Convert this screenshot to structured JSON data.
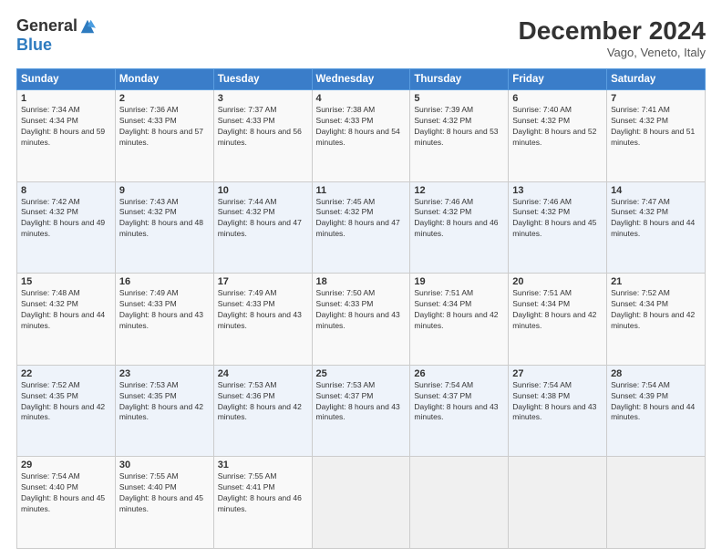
{
  "logo": {
    "general": "General",
    "blue": "Blue"
  },
  "title": "December 2024",
  "location": "Vago, Veneto, Italy",
  "headers": [
    "Sunday",
    "Monday",
    "Tuesday",
    "Wednesday",
    "Thursday",
    "Friday",
    "Saturday"
  ],
  "weeks": [
    [
      {
        "day": "1",
        "sunrise": "7:34 AM",
        "sunset": "4:34 PM",
        "daylight": "8 hours and 59 minutes."
      },
      {
        "day": "2",
        "sunrise": "7:36 AM",
        "sunset": "4:33 PM",
        "daylight": "8 hours and 57 minutes."
      },
      {
        "day": "3",
        "sunrise": "7:37 AM",
        "sunset": "4:33 PM",
        "daylight": "8 hours and 56 minutes."
      },
      {
        "day": "4",
        "sunrise": "7:38 AM",
        "sunset": "4:33 PM",
        "daylight": "8 hours and 54 minutes."
      },
      {
        "day": "5",
        "sunrise": "7:39 AM",
        "sunset": "4:32 PM",
        "daylight": "8 hours and 53 minutes."
      },
      {
        "day": "6",
        "sunrise": "7:40 AM",
        "sunset": "4:32 PM",
        "daylight": "8 hours and 52 minutes."
      },
      {
        "day": "7",
        "sunrise": "7:41 AM",
        "sunset": "4:32 PM",
        "daylight": "8 hours and 51 minutes."
      }
    ],
    [
      {
        "day": "8",
        "sunrise": "7:42 AM",
        "sunset": "4:32 PM",
        "daylight": "8 hours and 49 minutes."
      },
      {
        "day": "9",
        "sunrise": "7:43 AM",
        "sunset": "4:32 PM",
        "daylight": "8 hours and 48 minutes."
      },
      {
        "day": "10",
        "sunrise": "7:44 AM",
        "sunset": "4:32 PM",
        "daylight": "8 hours and 47 minutes."
      },
      {
        "day": "11",
        "sunrise": "7:45 AM",
        "sunset": "4:32 PM",
        "daylight": "8 hours and 47 minutes."
      },
      {
        "day": "12",
        "sunrise": "7:46 AM",
        "sunset": "4:32 PM",
        "daylight": "8 hours and 46 minutes."
      },
      {
        "day": "13",
        "sunrise": "7:46 AM",
        "sunset": "4:32 PM",
        "daylight": "8 hours and 45 minutes."
      },
      {
        "day": "14",
        "sunrise": "7:47 AM",
        "sunset": "4:32 PM",
        "daylight": "8 hours and 44 minutes."
      }
    ],
    [
      {
        "day": "15",
        "sunrise": "7:48 AM",
        "sunset": "4:32 PM",
        "daylight": "8 hours and 44 minutes."
      },
      {
        "day": "16",
        "sunrise": "7:49 AM",
        "sunset": "4:33 PM",
        "daylight": "8 hours and 43 minutes."
      },
      {
        "day": "17",
        "sunrise": "7:49 AM",
        "sunset": "4:33 PM",
        "daylight": "8 hours and 43 minutes."
      },
      {
        "day": "18",
        "sunrise": "7:50 AM",
        "sunset": "4:33 PM",
        "daylight": "8 hours and 43 minutes."
      },
      {
        "day": "19",
        "sunrise": "7:51 AM",
        "sunset": "4:34 PM",
        "daylight": "8 hours and 42 minutes."
      },
      {
        "day": "20",
        "sunrise": "7:51 AM",
        "sunset": "4:34 PM",
        "daylight": "8 hours and 42 minutes."
      },
      {
        "day": "21",
        "sunrise": "7:52 AM",
        "sunset": "4:34 PM",
        "daylight": "8 hours and 42 minutes."
      }
    ],
    [
      {
        "day": "22",
        "sunrise": "7:52 AM",
        "sunset": "4:35 PM",
        "daylight": "8 hours and 42 minutes."
      },
      {
        "day": "23",
        "sunrise": "7:53 AM",
        "sunset": "4:35 PM",
        "daylight": "8 hours and 42 minutes."
      },
      {
        "day": "24",
        "sunrise": "7:53 AM",
        "sunset": "4:36 PM",
        "daylight": "8 hours and 42 minutes."
      },
      {
        "day": "25",
        "sunrise": "7:53 AM",
        "sunset": "4:37 PM",
        "daylight": "8 hours and 43 minutes."
      },
      {
        "day": "26",
        "sunrise": "7:54 AM",
        "sunset": "4:37 PM",
        "daylight": "8 hours and 43 minutes."
      },
      {
        "day": "27",
        "sunrise": "7:54 AM",
        "sunset": "4:38 PM",
        "daylight": "8 hours and 43 minutes."
      },
      {
        "day": "28",
        "sunrise": "7:54 AM",
        "sunset": "4:39 PM",
        "daylight": "8 hours and 44 minutes."
      }
    ],
    [
      {
        "day": "29",
        "sunrise": "7:54 AM",
        "sunset": "4:40 PM",
        "daylight": "8 hours and 45 minutes."
      },
      {
        "day": "30",
        "sunrise": "7:55 AM",
        "sunset": "4:40 PM",
        "daylight": "8 hours and 45 minutes."
      },
      {
        "day": "31",
        "sunrise": "7:55 AM",
        "sunset": "4:41 PM",
        "daylight": "8 hours and 46 minutes."
      },
      null,
      null,
      null,
      null
    ]
  ]
}
